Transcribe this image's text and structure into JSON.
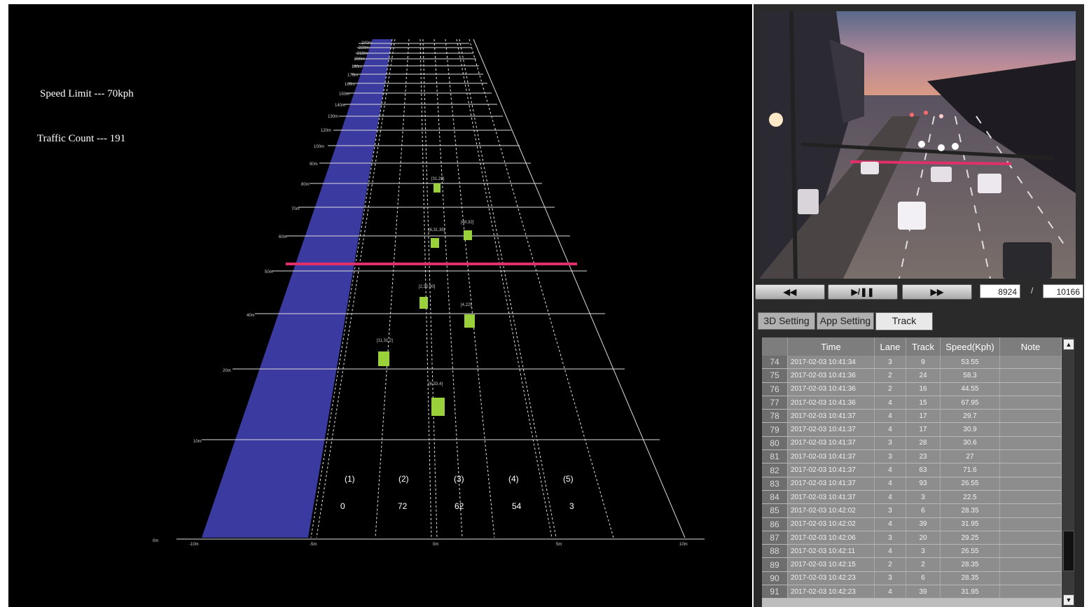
{
  "info": {
    "speed_limit": "Speed Limit --- 70kph",
    "traffic_count": "Traffic Count --- 191"
  },
  "lanes": {
    "labels": [
      "(1)",
      "(2)",
      "(3)",
      "(4)",
      "(5)"
    ],
    "counts": [
      "0",
      "72",
      "62",
      "54",
      "3"
    ]
  },
  "controls": {
    "rewind_label": "◀◀",
    "play_pause_label": "▶/❚❚",
    "forward_label": "▶▶",
    "current_frame": "8924",
    "separator": "/",
    "total_frames": "10166"
  },
  "tabs": [
    "3D Setting",
    "App Setting",
    "Track"
  ],
  "active_tab": "Track",
  "table": {
    "columns": [
      "",
      "Time",
      "Lane",
      "Track",
      "Speed(Kph)",
      "Note"
    ],
    "rows": [
      [
        "74",
        "2017-02-03 10:41:34",
        "3",
        "9",
        "53.55",
        ""
      ],
      [
        "75",
        "2017-02-03 10:41:36",
        "2",
        "24",
        "58.3",
        ""
      ],
      [
        "76",
        "2017-02-03 10:41:36",
        "2",
        "16",
        "44.55",
        ""
      ],
      [
        "77",
        "2017-02-03 10:41:36",
        "4",
        "15",
        "67.95",
        ""
      ],
      [
        "78",
        "2017-02-03 10:41:37",
        "4",
        "17",
        "29.7",
        ""
      ],
      [
        "79",
        "2017-02-03 10:41:37",
        "4",
        "17",
        "30.9",
        ""
      ],
      [
        "80",
        "2017-02-03 10:41:37",
        "3",
        "28",
        "30.6",
        ""
      ],
      [
        "81",
        "2017-02-03 10:41:37",
        "3",
        "23",
        "27",
        ""
      ],
      [
        "82",
        "2017-02-03 10:41:37",
        "4",
        "63",
        "71.6",
        ""
      ],
      [
        "83",
        "2017-02-03 10:41:37",
        "4",
        "93",
        "26.55",
        ""
      ],
      [
        "84",
        "2017-02-03 10:41:37",
        "4",
        "3",
        "22.5",
        ""
      ],
      [
        "85",
        "2017-02-03 10:42:02",
        "3",
        "6",
        "28.35",
        ""
      ],
      [
        "86",
        "2017-02-03 10:42:02",
        "4",
        "39",
        "31.95",
        ""
      ],
      [
        "87",
        "2017-02-03 10:42:06",
        "3",
        "20",
        "29.25",
        ""
      ],
      [
        "88",
        "2017-02-03 10:42:11",
        "4",
        "3",
        "26.55",
        ""
      ],
      [
        "89",
        "2017-02-03 10:42:15",
        "2",
        "2",
        "28.35",
        ""
      ],
      [
        "90",
        "2017-02-03 10:42:23",
        "3",
        "6",
        "28.35",
        ""
      ],
      [
        "91",
        "2017-02-03 10:42:23",
        "4",
        "39",
        "31.95",
        ""
      ]
    ]
  },
  "colors": {
    "background": "#000000",
    "sidewalk": "#3a3a9a",
    "vehicle": "#9ad13a",
    "detection_line": "#e0306a",
    "grid": "#d8d8d8",
    "panel": "#2a2a2a"
  },
  "icons": {
    "scroll_up": "triangle-up-icon",
    "scroll_down": "triangle-down-icon"
  }
}
